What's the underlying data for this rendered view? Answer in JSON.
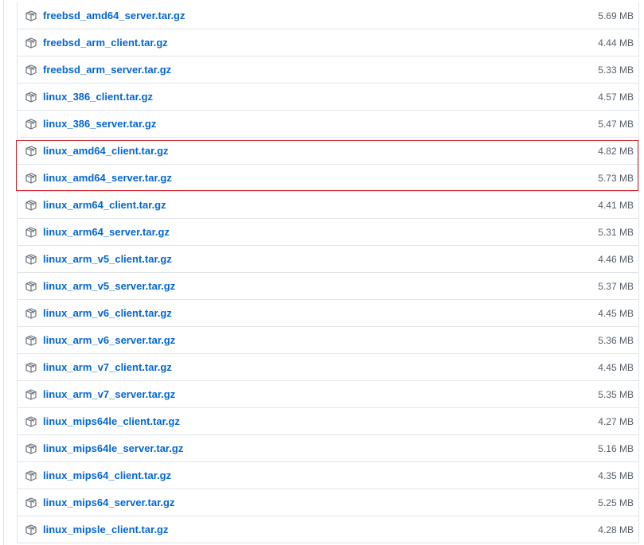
{
  "assets": [
    {
      "name": "freebsd_amd64_server.tar.gz",
      "size": "5.69 MB",
      "icon": "package-icon"
    },
    {
      "name": "freebsd_arm_client.tar.gz",
      "size": "4.44 MB",
      "icon": "package-icon"
    },
    {
      "name": "freebsd_arm_server.tar.gz",
      "size": "5.33 MB",
      "icon": "package-icon"
    },
    {
      "name": "linux_386_client.tar.gz",
      "size": "4.57 MB",
      "icon": "package-icon"
    },
    {
      "name": "linux_386_server.tar.gz",
      "size": "5.47 MB",
      "icon": "package-icon"
    },
    {
      "name": "linux_amd64_client.tar.gz",
      "size": "4.82 MB",
      "icon": "package-icon"
    },
    {
      "name": "linux_amd64_server.tar.gz",
      "size": "5.73 MB",
      "icon": "package-icon"
    },
    {
      "name": "linux_arm64_client.tar.gz",
      "size": "4.41 MB",
      "icon": "package-icon"
    },
    {
      "name": "linux_arm64_server.tar.gz",
      "size": "5.31 MB",
      "icon": "package-icon"
    },
    {
      "name": "linux_arm_v5_client.tar.gz",
      "size": "4.46 MB",
      "icon": "package-icon"
    },
    {
      "name": "linux_arm_v5_server.tar.gz",
      "size": "5.37 MB",
      "icon": "package-icon"
    },
    {
      "name": "linux_arm_v6_client.tar.gz",
      "size": "4.45 MB",
      "icon": "package-icon"
    },
    {
      "name": "linux_arm_v6_server.tar.gz",
      "size": "5.36 MB",
      "icon": "package-icon"
    },
    {
      "name": "linux_arm_v7_client.tar.gz",
      "size": "4.45 MB",
      "icon": "package-icon"
    },
    {
      "name": "linux_arm_v7_server.tar.gz",
      "size": "5.35 MB",
      "icon": "package-icon"
    },
    {
      "name": "linux_mips64le_client.tar.gz",
      "size": "4.27 MB",
      "icon": "package-icon"
    },
    {
      "name": "linux_mips64le_server.tar.gz",
      "size": "5.16 MB",
      "icon": "package-icon"
    },
    {
      "name": "linux_mips64_client.tar.gz",
      "size": "4.35 MB",
      "icon": "package-icon"
    },
    {
      "name": "linux_mips64_server.tar.gz",
      "size": "5.25 MB",
      "icon": "package-icon"
    },
    {
      "name": "linux_mipsle_client.tar.gz",
      "size": "4.28 MB",
      "icon": "package-icon"
    }
  ],
  "highlighted_assets": [
    "linux_amd64_client.tar.gz",
    "linux_amd64_server.tar.gz"
  ],
  "colors": {
    "link": "#0366d6",
    "size_text": "#586069",
    "border": "#e1e4e8",
    "highlight": "#d0202a"
  }
}
